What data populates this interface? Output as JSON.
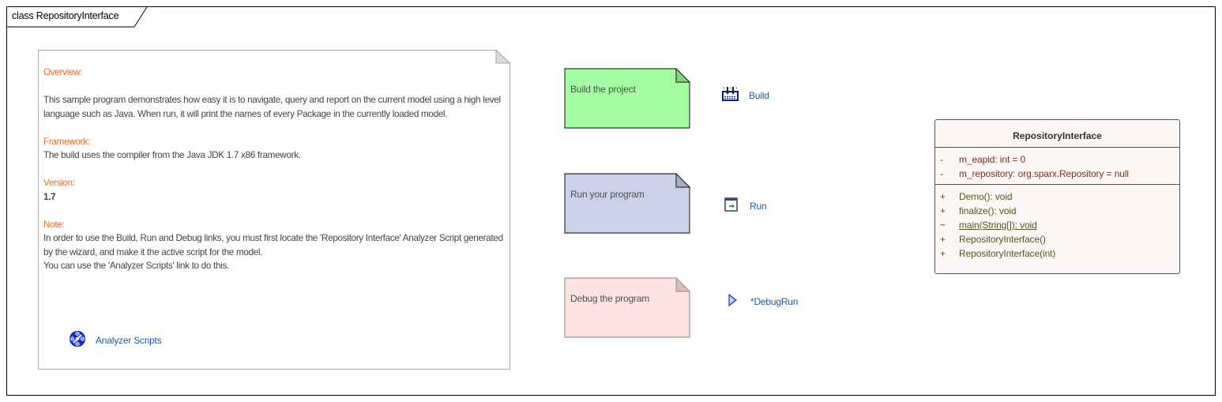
{
  "frame": {
    "title": "class RepositoryInterface"
  },
  "overview_note": {
    "overview_heading": "Overview:",
    "overview_text": "This sample program demonstrates how easy it is to navigate, query and report on the current model using a high level language such as Java. When run, it will print the names of every Package in the currently loaded model.",
    "framework_heading": "Framework:",
    "framework_text": "The build uses the compiler from the Java JDK 1.7 x86 framework.",
    "version_heading": "Version:",
    "version_text": "1.7",
    "note_heading": "Note:",
    "note_text_1": "In order to use the Build, Run and Debug links, you must first locate the 'Repository Interface' Analyzer Script generated by the wizard, and make it the active script for the model.",
    "note_text_2": "You can use the 'Analyzer Scripts' link to do this.",
    "link": {
      "label": "Analyzer Scripts",
      "icon": "analyzer-scripts-icon"
    }
  },
  "steps": [
    {
      "note": "Build the project",
      "link": "Build",
      "icon": "build-icon",
      "fill": "#a4fca0",
      "fold": "#7fd87b",
      "stroke": "#333333"
    },
    {
      "note": "Run your program",
      "link": "Run",
      "icon": "run-icon",
      "fill": "#cad2ea",
      "fold": "#a7afc7",
      "stroke": "#333333"
    },
    {
      "note": "Debug the program",
      "link": "*DebugRun",
      "icon": "debug-run-icon",
      "fill": "#fde3e0",
      "fold": "#dbbcb8",
      "stroke": "#999999"
    }
  ],
  "class": {
    "name": "RepositoryInterface",
    "attributes": [
      {
        "vis": "-",
        "text": "m_eapid: int = 0"
      },
      {
        "vis": "-",
        "text": "m_repository: org.sparx.Repository = null"
      }
    ],
    "operations": [
      {
        "vis": "+",
        "text": "Demo(): void"
      },
      {
        "vis": "+",
        "text": "finalize(): void"
      },
      {
        "vis": "~",
        "text": "main(String[]): void",
        "static": true
      },
      {
        "vis": "+",
        "text": "RepositoryInterface()"
      },
      {
        "vis": "+",
        "text": "RepositoryInterface(int)"
      }
    ]
  },
  "colors": {
    "heading": "#ef6a22",
    "link": "#1d5a94",
    "class_fill": "#fdf8f5",
    "attribute_text": "#7b2f1c",
    "operation_text": "#4a5a1a"
  }
}
